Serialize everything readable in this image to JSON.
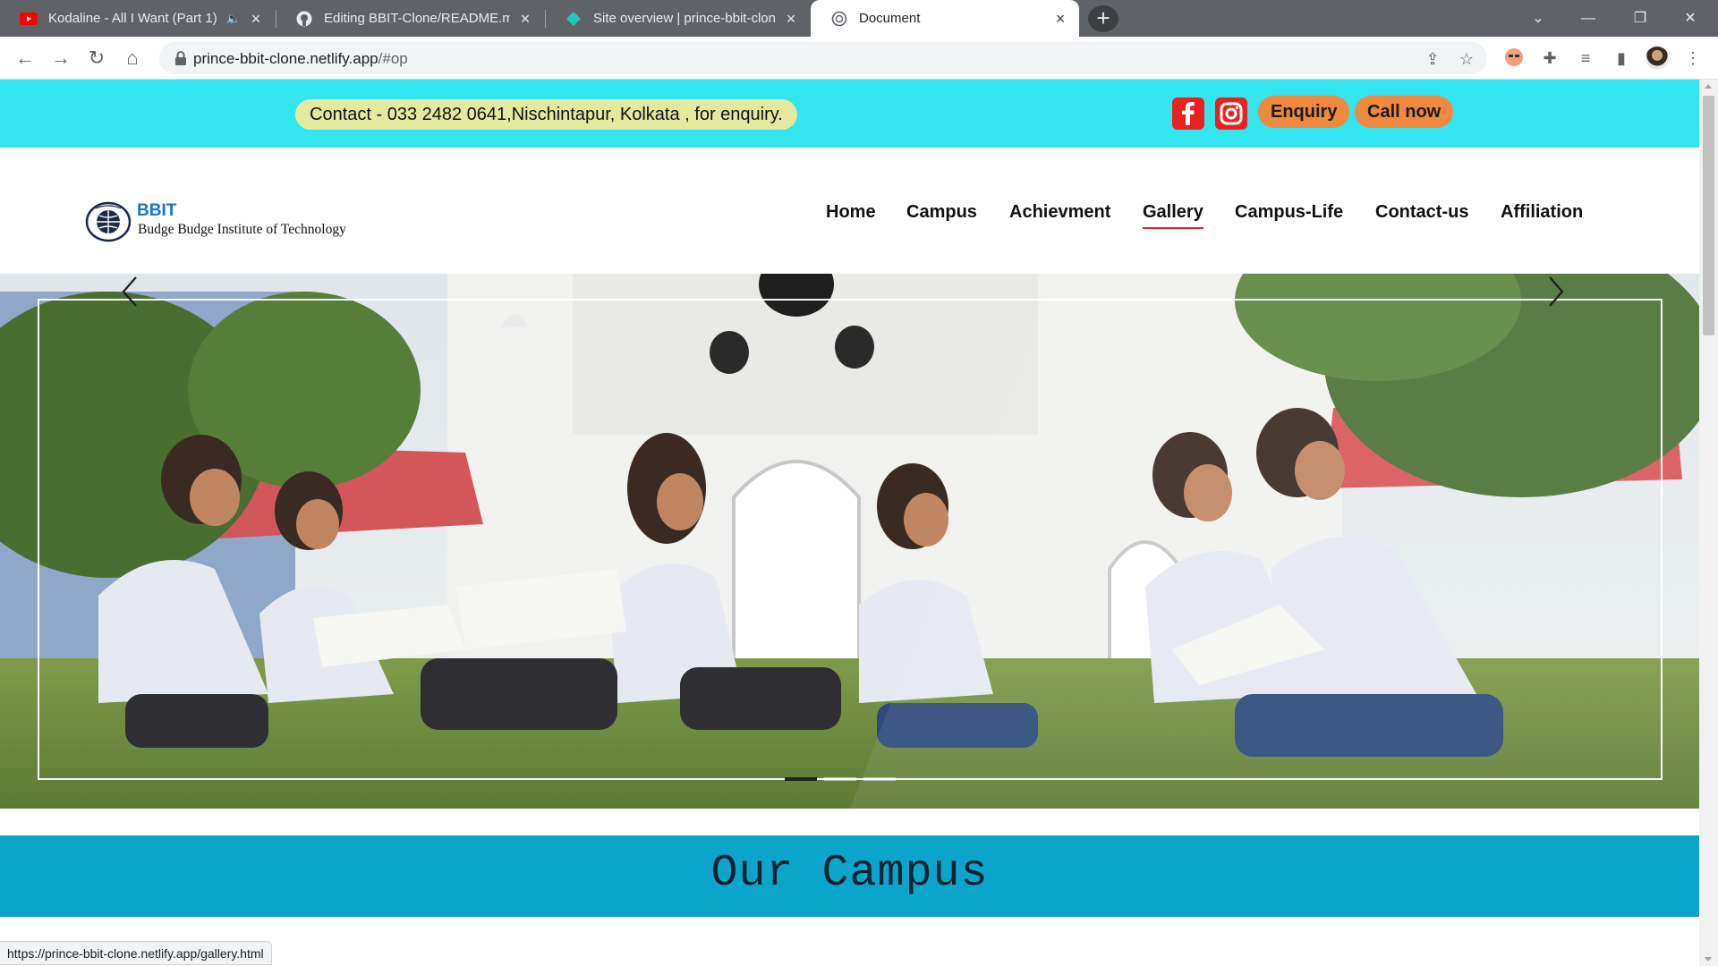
{
  "browser": {
    "tabs": [
      {
        "title": "Kodaline - All I Want (Part 1)",
        "favicon": "youtube-icon",
        "audio": true
      },
      {
        "title": "Editing BBIT-Clone/README.md",
        "favicon": "github-icon"
      },
      {
        "title": "Site overview | prince-bbit-clone",
        "favicon": "netlify-icon"
      },
      {
        "title": "Document",
        "favicon": "globe-icon",
        "active": true
      }
    ],
    "url_host": "prince-bbit-clone.netlify.app",
    "url_path": "/#op",
    "status_url": "https://prince-bbit-clone.netlify.app/gallery.html"
  },
  "topbar": {
    "contact_text": "Contact - 033 2482 0641,Nischintapur, Kolkata , for enquiry.",
    "enquiry_label": "Enquiry",
    "call_label": "Call now",
    "social_icons": [
      "facebook-icon",
      "instagram-icon"
    ]
  },
  "brand": {
    "short_name": "BBIT",
    "full_name": "Budge Budge Institute of Technology"
  },
  "nav": {
    "items": [
      "Home",
      "Campus",
      "Achievment",
      "Gallery",
      "Campus-Life",
      "Contact-us",
      "Affiliation"
    ],
    "active": "Gallery"
  },
  "hero": {
    "slide_count": 3,
    "active_slide": 1
  },
  "campus": {
    "title": "Our Campus"
  },
  "colors": {
    "topbar_bg": "#32e5ef",
    "contact_pill": "#e3eaa0",
    "button_orange": "#f0883e",
    "social_red": "#e8231f",
    "brand_blue": "#1a73d9",
    "nav_active_underline": "#e02222",
    "campus_banner": "#0aa5c9"
  }
}
